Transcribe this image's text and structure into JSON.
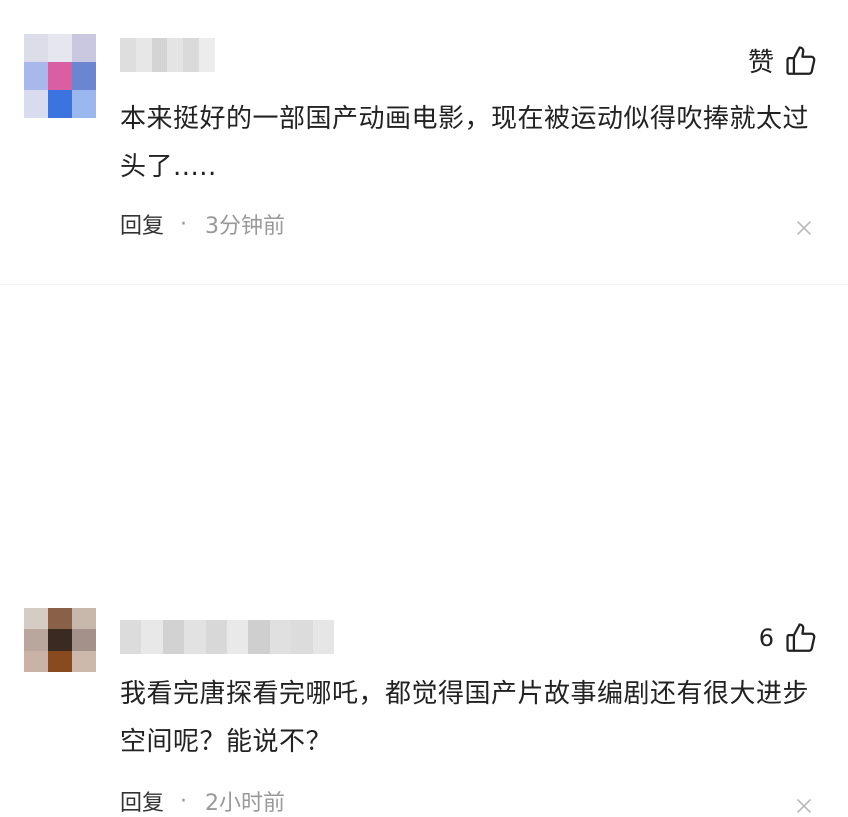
{
  "comments": [
    {
      "like_label": "赞",
      "like_count": "",
      "text": "本来挺好的一部国产动画电影，现在被运动似得吹捧就太过头了.....",
      "reply_label": "回复",
      "separator": "·",
      "time": "3分钟前"
    },
    {
      "like_label": "",
      "like_count": "6",
      "text": "我看完唐探看完哪吒，都觉得国产片故事编剧还有很大进步空间呢？能说不？",
      "reply_label": "回复",
      "separator": "·",
      "time": "2小时前"
    }
  ],
  "icons": {
    "thumb": "thumbs-up-icon",
    "close": "close-icon"
  },
  "colors": {
    "text": "#222222",
    "meta": "#999999",
    "icon": "#222222",
    "close": "#bbbbbb"
  }
}
